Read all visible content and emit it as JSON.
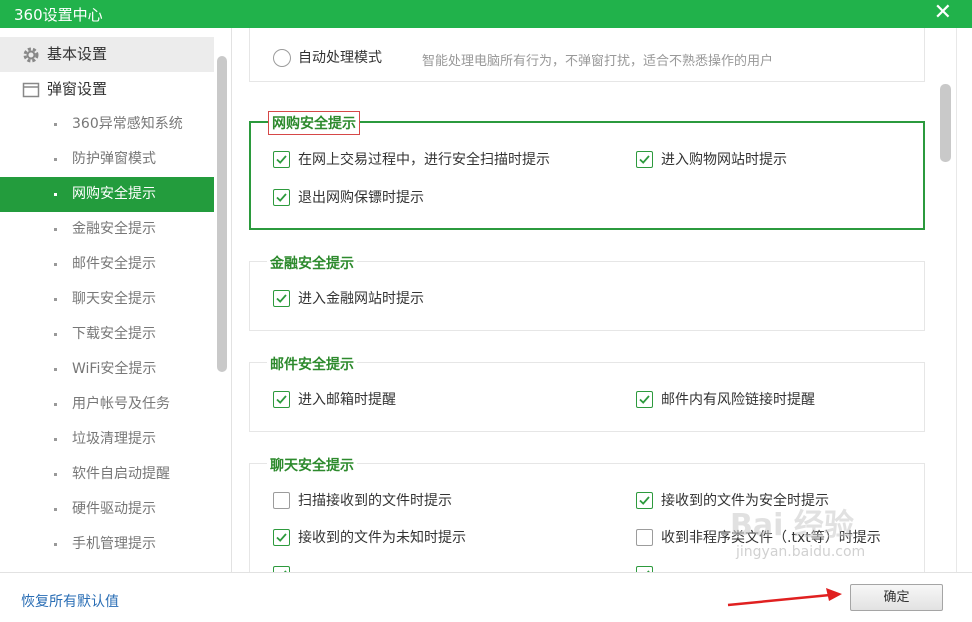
{
  "window": {
    "title": "360设置中心"
  },
  "sidebar": {
    "groups": [
      {
        "label": "基本设置",
        "icon": "gear-icon"
      },
      {
        "label": "弹窗设置",
        "icon": "window-icon"
      }
    ],
    "items": [
      {
        "label": "360异常感知系统"
      },
      {
        "label": "防护弹窗模式"
      },
      {
        "label": "网购安全提示"
      },
      {
        "label": "金融安全提示"
      },
      {
        "label": "邮件安全提示"
      },
      {
        "label": "聊天安全提示"
      },
      {
        "label": "下载安全提示"
      },
      {
        "label": "WiFi安全提示"
      },
      {
        "label": "用户帐号及任务"
      },
      {
        "label": "垃圾清理提示"
      },
      {
        "label": "软件自启动提醒"
      },
      {
        "label": "硬件驱动提示"
      },
      {
        "label": "手机管理提示"
      }
    ],
    "active_index": 2
  },
  "main": {
    "auto_mode": {
      "label": "自动处理模式",
      "description": "智能处理电脑所有行为，不弹窗打扰，适合不熟悉操作的用户",
      "selected": false
    },
    "shopping": {
      "title": "网购安全提示",
      "options": [
        {
          "label": "在网上交易过程中，进行安全扫描时提示",
          "checked": true
        },
        {
          "label": "进入购物网站时提示",
          "checked": true
        },
        {
          "label": "退出网购保镖时提示",
          "checked": true
        }
      ]
    },
    "finance": {
      "title": "金融安全提示",
      "options": [
        {
          "label": "进入金融网站时提示",
          "checked": true
        }
      ]
    },
    "mail": {
      "title": "邮件安全提示",
      "options": [
        {
          "label": "进入邮箱时提醒",
          "checked": true
        },
        {
          "label": "邮件内有风险链接时提醒",
          "checked": true
        }
      ]
    },
    "chat": {
      "title": "聊天安全提示",
      "options": [
        {
          "label": "扫描接收到的文件时提示",
          "checked": false
        },
        {
          "label": "接收到的文件为安全时提示",
          "checked": true
        },
        {
          "label": "接收到的文件为未知时提示",
          "checked": true
        },
        {
          "label": "收到非程序类文件（.txt等）时提示",
          "checked": false
        }
      ]
    }
  },
  "footer": {
    "restore_label": "恢复所有默认值",
    "ok_label": "确定"
  },
  "watermark": {
    "text": "Bai 经验",
    "sub": "jingyan.baidu.com"
  },
  "colors": {
    "titlebar": "#21b24b",
    "active_item": "#239c3d",
    "section_title": "#2d8a2d",
    "highlight_border": "#2b9a3d",
    "link": "#2a6eb5",
    "arrow": "#e02020"
  }
}
